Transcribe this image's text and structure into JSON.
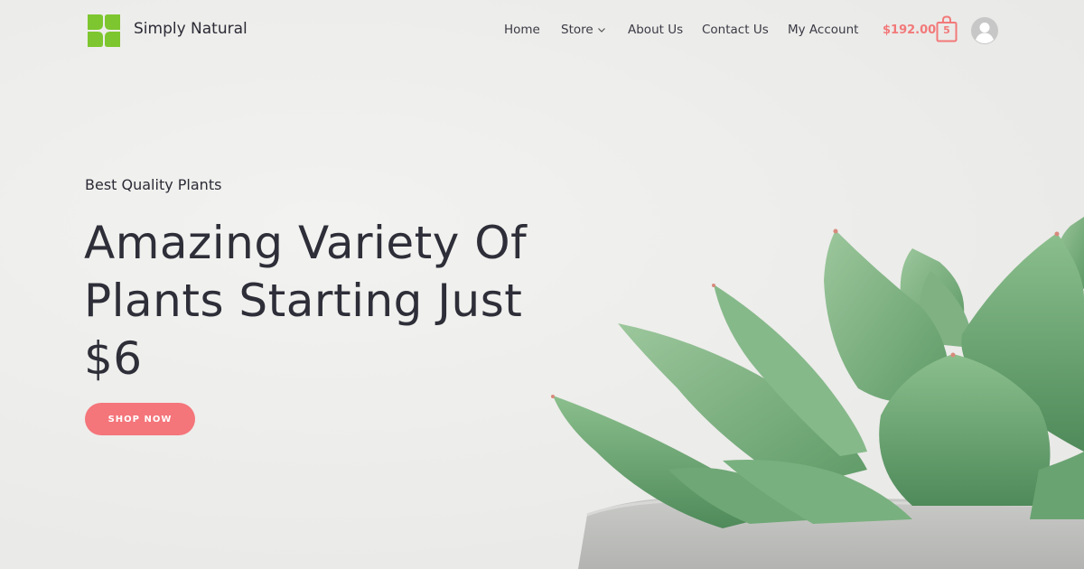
{
  "header": {
    "brand_name": "Simply Natural",
    "nav": [
      {
        "label": "Home"
      },
      {
        "label": "Store"
      },
      {
        "label": "About Us"
      },
      {
        "label": "Contact Us"
      },
      {
        "label": "My Account"
      }
    ],
    "cart_total": "$192.00",
    "cart_count": "5",
    "icons": {
      "logo": "four-leaf-logo-icon",
      "store_dropdown": "chevron-down-icon",
      "cart": "shopping-bag-icon",
      "account": "user-avatar-icon"
    }
  },
  "hero": {
    "eyebrow": "Best Quality Plants",
    "headline": "Amazing Variety Of Plants Starting Just $6",
    "cta_label": "SHOP NOW",
    "image": "succulent-plant-in-concrete-pot"
  },
  "colors": {
    "accent": "#f4757a",
    "logo_green": "#7dc62f",
    "text": "#2d2e38",
    "background": "#eeeeec"
  }
}
